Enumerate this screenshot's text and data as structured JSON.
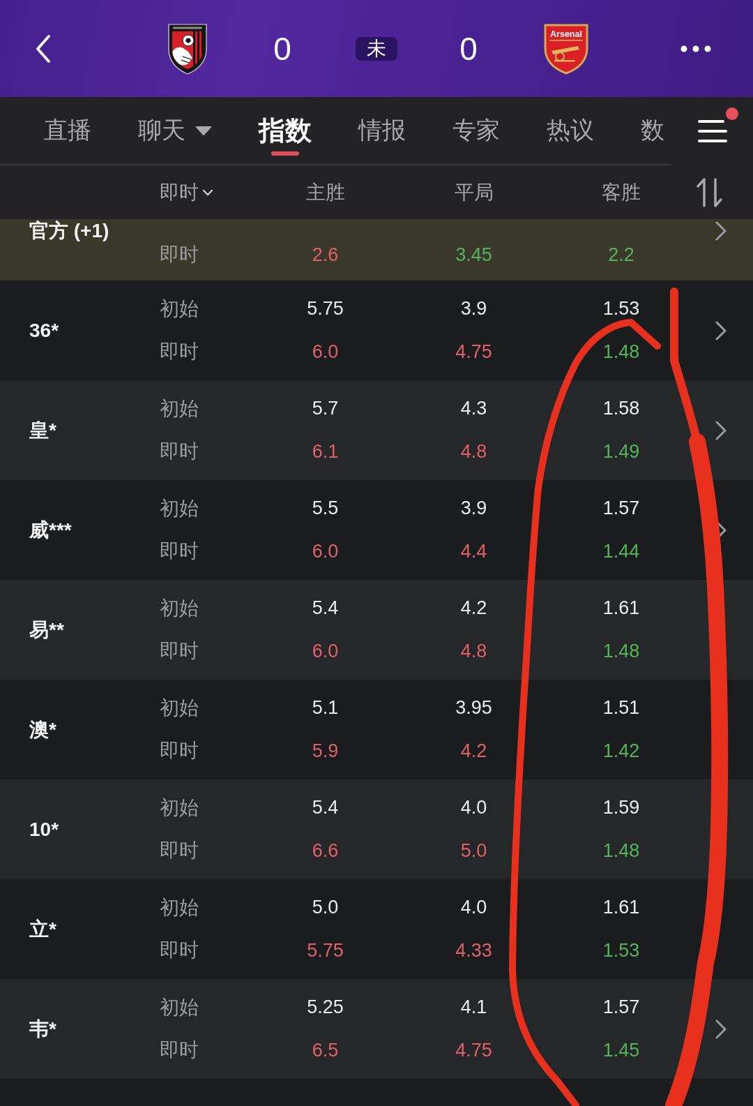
{
  "header": {
    "home_score": "0",
    "status": "未",
    "away_score": "0",
    "away_crest_text": "Arsenal"
  },
  "tabs": [
    {
      "label": "直播",
      "selected": false,
      "caret": false
    },
    {
      "label": "聊天",
      "selected": false,
      "caret": true
    },
    {
      "label": "指数",
      "selected": true,
      "caret": false
    },
    {
      "label": "情报",
      "selected": false,
      "caret": false
    },
    {
      "label": "专家",
      "selected": false,
      "caret": false
    },
    {
      "label": "热议",
      "selected": false,
      "caret": false
    },
    {
      "label": "数",
      "selected": false,
      "caret": false
    }
  ],
  "menu": {
    "badge": true
  },
  "columns": {
    "mode": {
      "label": "即时",
      "caret": true
    },
    "outcomes": [
      "主胜",
      "平局",
      "客胜"
    ]
  },
  "official": {
    "name": "官方 (+1)",
    "chevron": true,
    "live": {
      "label": "即时",
      "values": [
        {
          "value": "2.6",
          "color": "#e0606b"
        },
        {
          "value": "3.45",
          "color": "#55b35c"
        },
        {
          "value": "2.2",
          "color": "#55b35c"
        }
      ]
    }
  },
  "bookmakers": [
    {
      "name": "36*",
      "chevron": true,
      "initial": {
        "label": "初始",
        "values": [
          "5.75",
          "3.9",
          "1.53"
        ]
      },
      "live": {
        "label": "即时",
        "values": [
          {
            "value": "6.0",
            "color": "#e0606b"
          },
          {
            "value": "4.75",
            "color": "#e0606b"
          },
          {
            "value": "1.48",
            "color": "#55b35c"
          }
        ]
      }
    },
    {
      "name": "皇*",
      "chevron": true,
      "initial": {
        "label": "初始",
        "values": [
          "5.7",
          "4.3",
          "1.58"
        ]
      },
      "live": {
        "label": "即时",
        "values": [
          {
            "value": "6.1",
            "color": "#e0606b"
          },
          {
            "value": "4.8",
            "color": "#e0606b"
          },
          {
            "value": "1.49",
            "color": "#55b35c"
          }
        ]
      }
    },
    {
      "name": "威***",
      "chevron": true,
      "initial": {
        "label": "初始",
        "values": [
          "5.5",
          "3.9",
          "1.57"
        ]
      },
      "live": {
        "label": "即时",
        "values": [
          {
            "value": "6.0",
            "color": "#e0606b"
          },
          {
            "value": "4.4",
            "color": "#e0606b"
          },
          {
            "value": "1.44",
            "color": "#55b35c"
          }
        ]
      }
    },
    {
      "name": "易**",
      "chevron": false,
      "initial": {
        "label": "初始",
        "values": [
          "5.4",
          "4.2",
          "1.61"
        ]
      },
      "live": {
        "label": "即时",
        "values": [
          {
            "value": "6.0",
            "color": "#e0606b"
          },
          {
            "value": "4.8",
            "color": "#e0606b"
          },
          {
            "value": "1.48",
            "color": "#55b35c"
          }
        ]
      }
    },
    {
      "name": "澳*",
      "chevron": false,
      "initial": {
        "label": "初始",
        "values": [
          "5.1",
          "3.95",
          "1.51"
        ]
      },
      "live": {
        "label": "即时",
        "values": [
          {
            "value": "5.9",
            "color": "#e0606b"
          },
          {
            "value": "4.2",
            "color": "#e0606b"
          },
          {
            "value": "1.42",
            "color": "#55b35c"
          }
        ]
      }
    },
    {
      "name": "10*",
      "chevron": false,
      "initial": {
        "label": "初始",
        "values": [
          "5.4",
          "4.0",
          "1.59"
        ]
      },
      "live": {
        "label": "即时",
        "values": [
          {
            "value": "6.6",
            "color": "#e0606b"
          },
          {
            "value": "5.0",
            "color": "#e0606b"
          },
          {
            "value": "1.48",
            "color": "#55b35c"
          }
        ]
      }
    },
    {
      "name": "立*",
      "chevron": false,
      "initial": {
        "label": "初始",
        "values": [
          "5.0",
          "4.0",
          "1.61"
        ]
      },
      "live": {
        "label": "即时",
        "values": [
          {
            "value": "5.75",
            "color": "#e0606b"
          },
          {
            "value": "4.33",
            "color": "#e0606b"
          },
          {
            "value": "1.53",
            "color": "#55b35c"
          }
        ]
      }
    },
    {
      "name": "韦*",
      "chevron": true,
      "initial": {
        "label": "初始",
        "values": [
          "5.25",
          "4.1",
          "1.57"
        ]
      },
      "live": {
        "label": "即时",
        "values": [
          {
            "value": "6.5",
            "color": "#e0606b"
          },
          {
            "value": "4.75",
            "color": "#e0606b"
          },
          {
            "value": "1.45",
            "color": "#55b35c"
          }
        ]
      }
    }
  ]
}
